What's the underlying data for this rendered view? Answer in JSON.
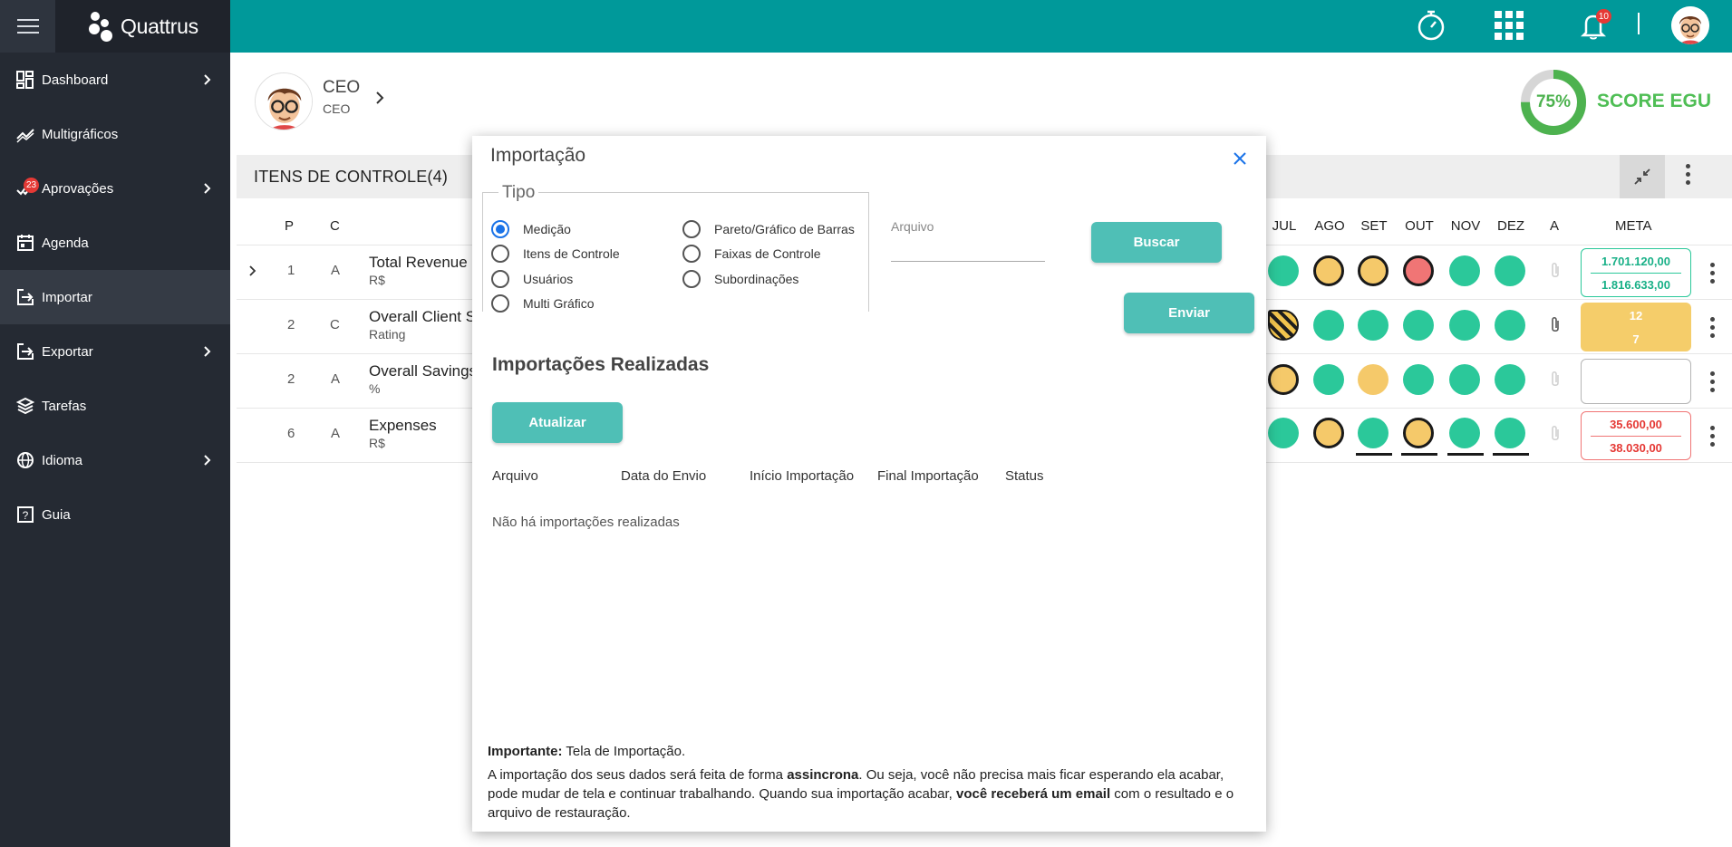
{
  "app": {
    "name": "Quattrus"
  },
  "sidebar": {
    "items": [
      {
        "label": "Dashboard",
        "icon": "dashboard-icon",
        "chevron": true
      },
      {
        "label": "Multigráficos",
        "icon": "trend-icon",
        "chevron": false
      },
      {
        "label": "Aprovações",
        "icon": "approval-icon",
        "chevron": true,
        "badge": "23"
      },
      {
        "label": "Agenda",
        "icon": "calendar-icon",
        "chevron": false
      },
      {
        "label": "Importar",
        "icon": "import-icon",
        "chevron": false
      },
      {
        "label": "Exportar",
        "icon": "export-icon",
        "chevron": true
      },
      {
        "label": "Tarefas",
        "icon": "layers-icon",
        "chevron": false
      },
      {
        "label": "Idioma",
        "icon": "globe-icon",
        "chevron": true
      },
      {
        "label": "Guia",
        "icon": "help-icon",
        "chevron": false
      }
    ]
  },
  "header": {
    "notifications_badge": "10"
  },
  "profile": {
    "name": "CEO",
    "role": "CEO"
  },
  "score": {
    "percent": "75%",
    "value": 0.75,
    "label": "SCORE EGU",
    "color": "#4db24f"
  },
  "section": {
    "title": "ITENS DE CONTROLE(4)"
  },
  "table": {
    "headers": {
      "p": "P",
      "c": "C",
      "a": "A",
      "meta": "META"
    },
    "months": [
      "JUL",
      "AGO",
      "SET",
      "OUT",
      "NOV",
      "DEZ"
    ],
    "rows": [
      {
        "p": "1",
        "c": "A",
        "name": "Total Revenue",
        "unit": "R$",
        "meta_top": "1.701.120,00",
        "meta_bottom": "1.816.633,00"
      },
      {
        "p": "2",
        "c": "C",
        "name": "Overall Client S",
        "unit": "Rating",
        "meta_top": "12",
        "meta_bottom": "7"
      },
      {
        "p": "2",
        "c": "A",
        "name": "Overall Savings",
        "unit": "%",
        "meta_top": "",
        "meta_bottom": ""
      },
      {
        "p": "6",
        "c": "A",
        "name": "Expenses",
        "unit": "R$",
        "meta_top": "35.600,00",
        "meta_bottom": "38.030,00"
      }
    ]
  },
  "modal": {
    "title": "Importação",
    "tipo_legend": "Tipo",
    "radios": [
      {
        "label": "Medição",
        "selected": true
      },
      {
        "label": "Itens de Controle",
        "selected": false
      },
      {
        "label": "Usuários",
        "selected": false
      },
      {
        "label": "Multi Gráfico",
        "selected": false
      },
      {
        "label": "Pareto/Gráfico de Barras",
        "selected": false
      },
      {
        "label": "Faixas de Controle",
        "selected": false
      },
      {
        "label": "Subordinações",
        "selected": false
      }
    ],
    "file_label": "Arquivo",
    "file_value": "",
    "buscar_label": "Buscar",
    "enviar_label": "Enviar",
    "imports_title": "Importações Realizadas",
    "atualizar_label": "Atualizar",
    "columns": [
      "Arquivo",
      "Data do Envio",
      "Início Importação",
      "Final Importação",
      "Status"
    ],
    "empty_message": "Não há importações realizadas",
    "note_bold_label": "Importante:",
    "note_intro": " Tela de Importação.",
    "note_p1": "A importação dos seus dados será feita de forma ",
    "note_bold_async": "assincrona",
    "note_p2": ". Ou seja, você não precisa mais ficar esperando ela acabar, pode mudar de tela e continuar trabalhando. Quando sua importação acabar, ",
    "note_bold_email": "você receberá um email",
    "note_p3": " com o resultado e o arquivo de restauração."
  },
  "colors": {
    "header": "#00999a",
    "sidebar": "#252a33",
    "status_green": "#2bc89a",
    "status_yellow": "#f5c96a",
    "status_red": "#f07575",
    "button_teal": "#4fbfb6",
    "radio_selected": "#1a73e8"
  }
}
